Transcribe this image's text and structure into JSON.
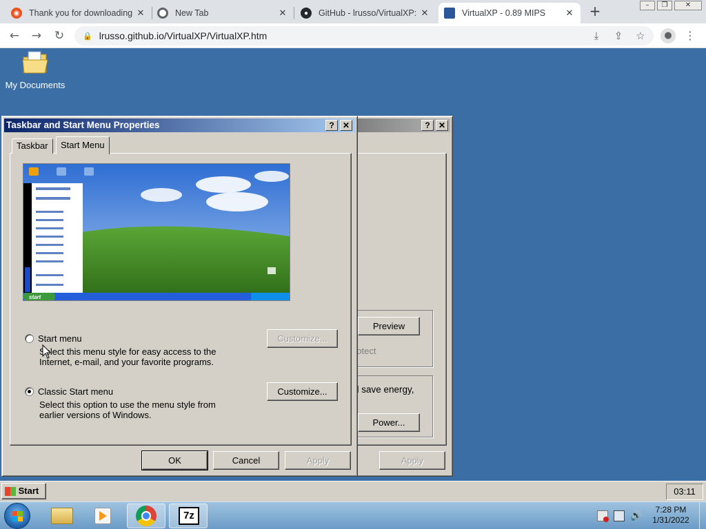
{
  "browser": {
    "tabs": [
      {
        "title": "Thank you for downloading",
        "icon": "ubuntu-icon",
        "color": "#e95420"
      },
      {
        "title": "New Tab",
        "icon": "chrome-icon",
        "color": "#5f6368"
      },
      {
        "title": "GitHub - lrusso/VirtualXP: V",
        "icon": "github-icon",
        "color": "#24292e"
      },
      {
        "title": "VirtualXP - 0.89 MIPS",
        "icon": "virtualxp-icon",
        "color": "#2b579a",
        "active": true
      }
    ],
    "close_glyph": "✕",
    "new_tab_glyph": "+",
    "url": "lrusso.github.io/VirtualXP/VirtualXP.htm"
  },
  "desktop": {
    "icons": [
      {
        "label": "My Documents",
        "icon": "my-documents-folder-icon"
      }
    ]
  },
  "dialog": {
    "title": "Taskbar and Start Menu Properties",
    "help_glyph": "?",
    "close_glyph": "✕",
    "tabs": [
      "Taskbar",
      "Start Menu"
    ],
    "active_tab": "Start Menu",
    "preview_start_label": "start",
    "options": [
      {
        "label": "Start menu",
        "description_line1": "Select this menu style for easy access to the",
        "description_line2": "Internet, e-mail, and your favorite programs.",
        "selected": false,
        "button": "Customize...",
        "button_enabled": false
      },
      {
        "label": "Classic Start menu",
        "description_line1": "Select this option to use the menu style from",
        "description_line2": "earlier versions of Windows.",
        "selected": true,
        "button": "Customize...",
        "button_enabled": true
      }
    ],
    "buttons": {
      "ok": "OK",
      "cancel": "Cancel",
      "apply": "Apply"
    }
  },
  "background_dialog": {
    "preview_button": "Preview",
    "protect_text": "rotect",
    "energy_text": "d save energy,",
    "power_button": "Power...",
    "apply_button": "Apply"
  },
  "xp_taskbar": {
    "start_label": "Start",
    "clock": "03:11"
  },
  "win7_taskbar": {
    "apps": [
      "file-explorer-icon",
      "media-player-icon",
      "chrome-icon",
      "7zip-icon"
    ],
    "time": "7:28 PM",
    "date": "1/31/2022",
    "seven_zip_label": "7z"
  }
}
